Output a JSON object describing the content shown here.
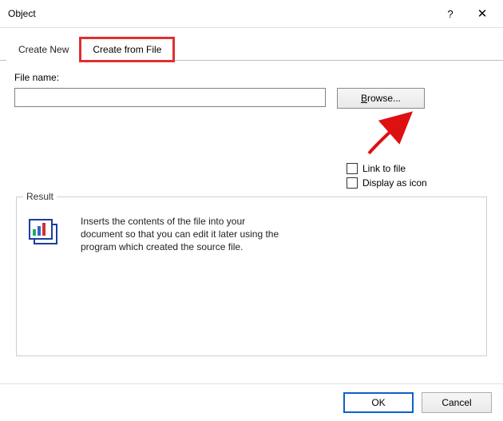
{
  "titlebar": {
    "title": "Object",
    "help": "?",
    "close": "✕"
  },
  "tabs": {
    "create_new": "Create New",
    "create_from_file": "Create from File"
  },
  "filename": {
    "label": "File name:",
    "value": "",
    "browse_prefix": "B",
    "browse_suffix": "rowse..."
  },
  "checks": {
    "link": "Link to file",
    "icon": "Display as icon"
  },
  "result": {
    "legend": "Result",
    "text": "Inserts the contents of the file into your document so that you can edit it later using the program which created the source file."
  },
  "footer": {
    "ok": "OK",
    "cancel": "Cancel"
  }
}
